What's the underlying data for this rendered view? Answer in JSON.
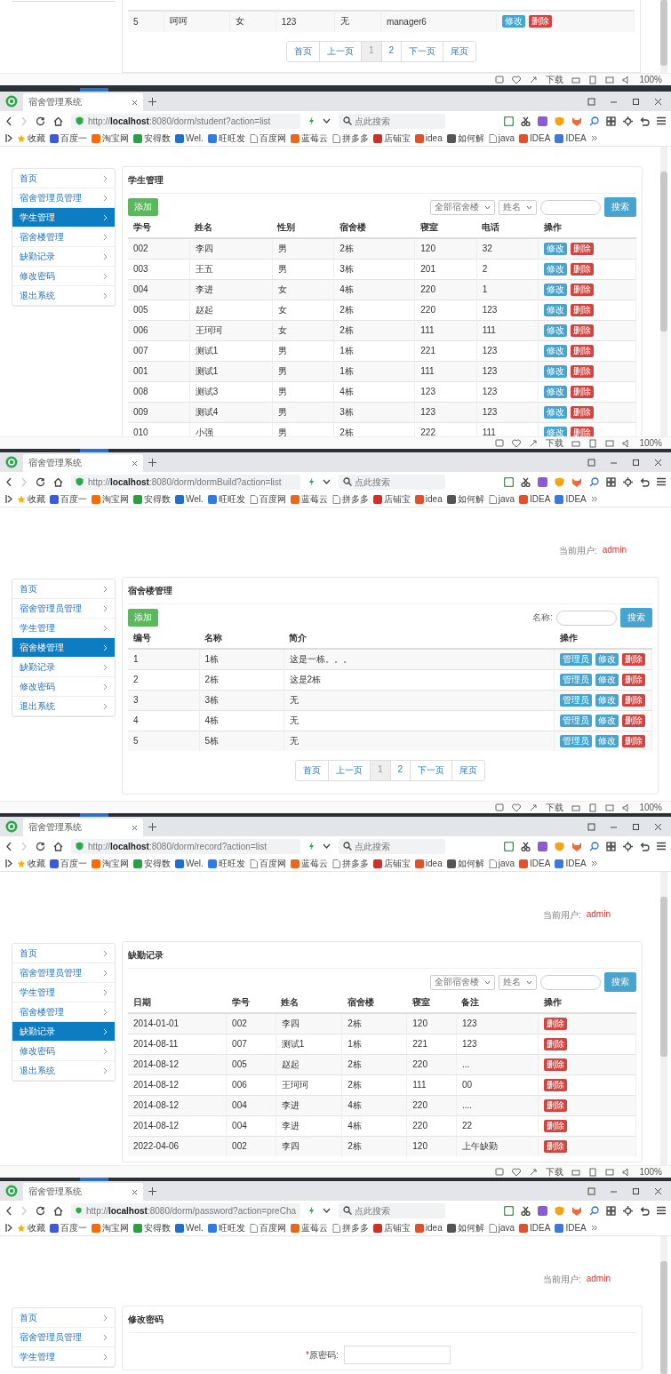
{
  "fragment": {
    "rows": [
      {
        "cells": [
          "5",
          "呵呵",
          "女",
          "123",
          "无",
          "manager6"
        ],
        "actions": [
          {
            "label": "修改",
            "kind": "edit"
          },
          {
            "label": "删除",
            "kind": "delete"
          }
        ]
      }
    ],
    "pager": [
      {
        "label": "首页",
        "selected": false
      },
      {
        "label": "上一页",
        "selected": false
      },
      {
        "label": "1",
        "selected": true
      },
      {
        "label": "2",
        "selected": false
      },
      {
        "label": "下一页",
        "selected": false
      },
      {
        "label": "尾页",
        "selected": false
      }
    ],
    "status_bar": {
      "download": "下载",
      "zoom": "100%"
    }
  },
  "windows": [
    {
      "tab_title": "宿舍管理系统",
      "url": "http://**localhost**:8080/dorm/student?action=list",
      "search_placeholder": "点此搜索",
      "scrollbar": true,
      "bookmarks": [
        {
          "label": "收藏",
          "kind": "star",
          "color": "#f5b301"
        },
        {
          "label": "百度一",
          "kind": "favicon",
          "color": "#3b5bdb"
        },
        {
          "label": "淘宝网",
          "kind": "favicon",
          "color": "#ff6a00"
        },
        {
          "label": "安得数",
          "kind": "favicon",
          "color": "#2e9e44"
        },
        {
          "label": "Wel.",
          "kind": "favicon",
          "color": "#1e6fd0"
        },
        {
          "label": "旺旺发",
          "kind": "favicon",
          "color": "#2d7be5"
        },
        {
          "label": "百度网",
          "kind": "page",
          "color": "#888888"
        },
        {
          "label": "蓝莓云",
          "kind": "favicon",
          "color": "#e8691e"
        },
        {
          "label": "拼多多",
          "kind": "page",
          "color": "#888888"
        },
        {
          "label": "店铺宝",
          "kind": "favicon",
          "color": "#d0302a"
        },
        {
          "label": "idea",
          "kind": "favicon",
          "color": "#e2502d"
        },
        {
          "label": "如何解",
          "kind": "favicon",
          "color": "#555555"
        },
        {
          "label": "java",
          "kind": "page",
          "color": "#888888"
        },
        {
          "label": "IDEA",
          "kind": "favicon",
          "color": "#e2502d"
        },
        {
          "label": "IDEA",
          "kind": "favicon",
          "color": "#3b7ad8"
        }
      ],
      "sidebar": [
        {
          "label": "首页",
          "selected": false
        },
        {
          "label": "宿舍管理员管理",
          "selected": false
        },
        {
          "label": "学生管理",
          "selected": true
        },
        {
          "label": "宿舍楼管理",
          "selected": false
        },
        {
          "label": "缺勤记录",
          "selected": false
        },
        {
          "label": "修改密码",
          "selected": false
        },
        {
          "label": "退出系统",
          "selected": false
        }
      ],
      "panel": {
        "title": "学生管理",
        "add_button": "添加",
        "filters": [
          {
            "kind": "dropdown",
            "value": "全部宿舍楼"
          },
          {
            "kind": "dropdown",
            "value": "姓名"
          },
          {
            "kind": "input"
          }
        ],
        "search_button": "搜索",
        "columns": [
          "学号",
          "姓名",
          "性别",
          "宿舍楼",
          "寝室",
          "电话",
          "操作"
        ],
        "rows": [
          {
            "cells": [
              "002",
              "李四",
              "男",
              "2栋",
              "120",
              "32"
            ],
            "actions": [
              {
                "label": "修改",
                "kind": "edit"
              },
              {
                "label": "删除",
                "kind": "delete"
              }
            ]
          },
          {
            "cells": [
              "003",
              "王五",
              "男",
              "3栋",
              "201",
              "2"
            ],
            "actions": [
              {
                "label": "修改",
                "kind": "edit"
              },
              {
                "label": "删除",
                "kind": "delete"
              }
            ]
          },
          {
            "cells": [
              "004",
              "李进",
              "女",
              "4栋",
              "220",
              "1"
            ],
            "actions": [
              {
                "label": "修改",
                "kind": "edit"
              },
              {
                "label": "删除",
                "kind": "delete"
              }
            ]
          },
          {
            "cells": [
              "005",
              "赵起",
              "女",
              "2栋",
              "220",
              "123"
            ],
            "actions": [
              {
                "label": "修改",
                "kind": "edit"
              },
              {
                "label": "删除",
                "kind": "delete"
              }
            ]
          },
          {
            "cells": [
              "006",
              "王珂珂",
              "女",
              "2栋",
              "111",
              "111"
            ],
            "actions": [
              {
                "label": "修改",
                "kind": "edit"
              },
              {
                "label": "删除",
                "kind": "delete"
              }
            ]
          },
          {
            "cells": [
              "007",
              "测试1",
              "男",
              "1栋",
              "221",
              "123"
            ],
            "actions": [
              {
                "label": "修改",
                "kind": "edit"
              },
              {
                "label": "删除",
                "kind": "delete"
              }
            ]
          },
          {
            "cells": [
              "001",
              "测试1",
              "男",
              "1栋",
              "111",
              "123"
            ],
            "actions": [
              {
                "label": "修改",
                "kind": "edit"
              },
              {
                "label": "删除",
                "kind": "delete"
              }
            ]
          },
          {
            "cells": [
              "008",
              "测试3",
              "男",
              "4栋",
              "123",
              "123"
            ],
            "actions": [
              {
                "label": "修改",
                "kind": "edit"
              },
              {
                "label": "删除",
                "kind": "delete"
              }
            ]
          },
          {
            "cells": [
              "009",
              "测试4",
              "男",
              "3栋",
              "123",
              "123"
            ],
            "actions": [
              {
                "label": "修改",
                "kind": "edit"
              },
              {
                "label": "删除",
                "kind": "delete"
              }
            ]
          },
          {
            "cells": [
              "010",
              "小强",
              "男",
              "2栋",
              "222",
              "111"
            ],
            "actions": [
              {
                "label": "修改",
                "kind": "edit"
              },
              {
                "label": "删除",
                "kind": "delete"
              }
            ]
          }
        ]
      },
      "status_bar": {
        "download": "下载",
        "zoom": "100%"
      }
    },
    {
      "tab_title": "宿舍管理系统",
      "url": "http://**localhost**:8080/dorm/dormBuild?action=list",
      "search_placeholder": "点此搜索",
      "scrollbar": false,
      "bookmarks": [
        {
          "label": "收藏",
          "kind": "star",
          "color": "#f5b301"
        },
        {
          "label": "百度一",
          "kind": "favicon",
          "color": "#3b5bdb"
        },
        {
          "label": "淘宝网",
          "kind": "favicon",
          "color": "#ff6a00"
        },
        {
          "label": "安得数",
          "kind": "favicon",
          "color": "#2e9e44"
        },
        {
          "label": "Wel.",
          "kind": "favicon",
          "color": "#1e6fd0"
        },
        {
          "label": "旺旺发",
          "kind": "favicon",
          "color": "#2d7be5"
        },
        {
          "label": "百度网",
          "kind": "page",
          "color": "#888888"
        },
        {
          "label": "蓝莓云",
          "kind": "favicon",
          "color": "#e8691e"
        },
        {
          "label": "拼多多",
          "kind": "page",
          "color": "#888888"
        },
        {
          "label": "店铺宝",
          "kind": "favicon",
          "color": "#d0302a"
        },
        {
          "label": "idea",
          "kind": "favicon",
          "color": "#e2502d"
        },
        {
          "label": "如何解",
          "kind": "favicon",
          "color": "#555555"
        },
        {
          "label": "java",
          "kind": "page",
          "color": "#888888"
        },
        {
          "label": "IDEA",
          "kind": "favicon",
          "color": "#e2502d"
        },
        {
          "label": "IDEA",
          "kind": "favicon",
          "color": "#3b7ad8"
        }
      ],
      "current_user": {
        "label": "当前用户:",
        "value": "admin"
      },
      "sidebar": [
        {
          "label": "首页",
          "selected": false
        },
        {
          "label": "宿舍管理员管理",
          "selected": false
        },
        {
          "label": "学生管理",
          "selected": false
        },
        {
          "label": "宿舍楼管理",
          "selected": true
        },
        {
          "label": "缺勤记录",
          "selected": false
        },
        {
          "label": "修改密码",
          "selected": false
        },
        {
          "label": "退出系统",
          "selected": false
        }
      ],
      "panel": {
        "title": "宿舍楼管理",
        "add_button": "添加",
        "filters": [
          {
            "kind": "label",
            "value": "名称:"
          },
          {
            "kind": "input"
          }
        ],
        "search_button": "搜索",
        "columns": [
          "编号",
          "名称",
          "简介",
          "操作"
        ],
        "rows": [
          {
            "cells": [
              "1",
              "1栋",
              "这是一栋。。。"
            ],
            "actions": [
              {
                "label": "管理员",
                "kind": "manage"
              },
              {
                "label": "修改",
                "kind": "edit"
              },
              {
                "label": "删除",
                "kind": "delete"
              }
            ]
          },
          {
            "cells": [
              "2",
              "2栋",
              "这是2栋"
            ],
            "actions": [
              {
                "label": "管理员",
                "kind": "manage"
              },
              {
                "label": "修改",
                "kind": "edit"
              },
              {
                "label": "删除",
                "kind": "delete"
              }
            ]
          },
          {
            "cells": [
              "3",
              "3栋",
              "无"
            ],
            "actions": [
              {
                "label": "管理员",
                "kind": "manage"
              },
              {
                "label": "修改",
                "kind": "edit"
              },
              {
                "label": "删除",
                "kind": "delete"
              }
            ]
          },
          {
            "cells": [
              "4",
              "4栋",
              "无"
            ],
            "actions": [
              {
                "label": "管理员",
                "kind": "manage"
              },
              {
                "label": "修改",
                "kind": "edit"
              },
              {
                "label": "删除",
                "kind": "delete"
              }
            ]
          },
          {
            "cells": [
              "5",
              "5栋",
              "无"
            ],
            "actions": [
              {
                "label": "管理员",
                "kind": "manage"
              },
              {
                "label": "修改",
                "kind": "edit"
              },
              {
                "label": "删除",
                "kind": "delete"
              }
            ]
          }
        ],
        "pager": [
          {
            "label": "首页",
            "selected": false
          },
          {
            "label": "上一页",
            "selected": false
          },
          {
            "label": "1",
            "selected": true
          },
          {
            "label": "2",
            "selected": false
          },
          {
            "label": "下一页",
            "selected": false
          },
          {
            "label": "尾页",
            "selected": false
          }
        ]
      },
      "status_bar": {
        "download": "下载",
        "zoom": "100%"
      }
    },
    {
      "tab_title": "宿舍管理系统",
      "url": "http://**localhost**:8080/dorm/record?action=list",
      "search_placeholder": "点此搜索",
      "scrollbar": true,
      "bookmarks": [
        {
          "label": "收藏",
          "kind": "star",
          "color": "#f5b301"
        },
        {
          "label": "百度一",
          "kind": "favicon",
          "color": "#3b5bdb"
        },
        {
          "label": "淘宝网",
          "kind": "favicon",
          "color": "#ff6a00"
        },
        {
          "label": "安得数",
          "kind": "favicon",
          "color": "#2e9e44"
        },
        {
          "label": "Wel.",
          "kind": "favicon",
          "color": "#1e6fd0"
        },
        {
          "label": "旺旺发",
          "kind": "favicon",
          "color": "#2d7be5"
        },
        {
          "label": "百度网",
          "kind": "page",
          "color": "#888888"
        },
        {
          "label": "蓝莓云",
          "kind": "favicon",
          "color": "#e8691e"
        },
        {
          "label": "拼多多",
          "kind": "page",
          "color": "#888888"
        },
        {
          "label": "店铺宝",
          "kind": "favicon",
          "color": "#d0302a"
        },
        {
          "label": "idea",
          "kind": "favicon",
          "color": "#e2502d"
        },
        {
          "label": "如何解",
          "kind": "favicon",
          "color": "#555555"
        },
        {
          "label": "java",
          "kind": "page",
          "color": "#888888"
        },
        {
          "label": "IDEA",
          "kind": "favicon",
          "color": "#e2502d"
        },
        {
          "label": "IDEA",
          "kind": "favicon",
          "color": "#3b7ad8"
        }
      ],
      "current_user": {
        "label": "当前用户:",
        "value": "admin"
      },
      "sidebar": [
        {
          "label": "首页",
          "selected": false
        },
        {
          "label": "宿舍管理员管理",
          "selected": false
        },
        {
          "label": "学生管理",
          "selected": false
        },
        {
          "label": "宿舍楼管理",
          "selected": false
        },
        {
          "label": "缺勤记录",
          "selected": true
        },
        {
          "label": "修改密码",
          "selected": false
        },
        {
          "label": "退出系统",
          "selected": false
        }
      ],
      "panel": {
        "title": "缺勤记录",
        "filters": [
          {
            "kind": "dropdown",
            "value": "全部宿舍楼"
          },
          {
            "kind": "dropdown",
            "value": "姓名"
          },
          {
            "kind": "input"
          }
        ],
        "search_button": "搜索",
        "columns": [
          "日期",
          "学号",
          "姓名",
          "宿舍楼",
          "寝室",
          "备注",
          "操作"
        ],
        "rows": [
          {
            "cells": [
              "2014-01-01",
              "002",
              "李四",
              "2栋",
              "120",
              "123"
            ],
            "actions": [
              {
                "label": "删除",
                "kind": "delete"
              }
            ]
          },
          {
            "cells": [
              "2014-08-11",
              "007",
              "测试1",
              "1栋",
              "221",
              "123"
            ],
            "actions": [
              {
                "label": "删除",
                "kind": "delete"
              }
            ]
          },
          {
            "cells": [
              "2014-08-12",
              "005",
              "赵起",
              "2栋",
              "220",
              "..."
            ],
            "actions": [
              {
                "label": "删除",
                "kind": "delete"
              }
            ]
          },
          {
            "cells": [
              "2014-08-12",
              "006",
              "王珂珂",
              "2栋",
              "111",
              "00"
            ],
            "actions": [
              {
                "label": "删除",
                "kind": "delete"
              }
            ]
          },
          {
            "cells": [
              "2014-08-12",
              "004",
              "李进",
              "4栋",
              "220",
              "...."
            ],
            "actions": [
              {
                "label": "删除",
                "kind": "delete"
              }
            ]
          },
          {
            "cells": [
              "2014-08-12",
              "004",
              "李进",
              "4栋",
              "220",
              "22"
            ],
            "actions": [
              {
                "label": "删除",
                "kind": "delete"
              }
            ]
          },
          {
            "cells": [
              "2022-04-06",
              "002",
              "李四",
              "2栋",
              "120",
              "上午缺勤"
            ],
            "actions": [
              {
                "label": "删除",
                "kind": "delete"
              }
            ]
          }
        ]
      },
      "status_bar": {
        "download": "下载",
        "zoom": "100%"
      }
    },
    {
      "tab_title": "宿舍管理系统",
      "url": "http://**localhost**:8080/dorm/password?action=preCha",
      "search_placeholder": "点此搜索",
      "scrollbar": true,
      "bookmarks": [
        {
          "label": "收藏",
          "kind": "star",
          "color": "#f5b301"
        },
        {
          "label": "百度一",
          "kind": "favicon",
          "color": "#3b5bdb"
        },
        {
          "label": "淘宝网",
          "kind": "favicon",
          "color": "#ff6a00"
        },
        {
          "label": "安得数",
          "kind": "favicon",
          "color": "#2e9e44"
        },
        {
          "label": "Wel.",
          "kind": "favicon",
          "color": "#1e6fd0"
        },
        {
          "label": "旺旺发",
          "kind": "favicon",
          "color": "#2d7be5"
        },
        {
          "label": "百度网",
          "kind": "page",
          "color": "#888888"
        },
        {
          "label": "蓝莓云",
          "kind": "favicon",
          "color": "#e8691e"
        },
        {
          "label": "拼多多",
          "kind": "page",
          "color": "#888888"
        },
        {
          "label": "店铺宝",
          "kind": "favicon",
          "color": "#d0302a"
        },
        {
          "label": "idea",
          "kind": "favicon",
          "color": "#e2502d"
        },
        {
          "label": "如何解",
          "kind": "favicon",
          "color": "#555555"
        },
        {
          "label": "java",
          "kind": "page",
          "color": "#888888"
        },
        {
          "label": "IDEA",
          "kind": "favicon",
          "color": "#e2502d"
        },
        {
          "label": "IDEA",
          "kind": "favicon",
          "color": "#3b7ad8"
        }
      ],
      "current_user": {
        "label": "当前用户:",
        "value": "admin"
      },
      "sidebar": [
        {
          "label": "首页",
          "selected": false
        },
        {
          "label": "宿舍管理员管理",
          "selected": false
        },
        {
          "label": "学生管理",
          "selected": false
        }
      ],
      "panel": {
        "title": "修改密码",
        "form": [
          {
            "required_mark": "*",
            "label": "原密码:"
          }
        ]
      }
    }
  ]
}
